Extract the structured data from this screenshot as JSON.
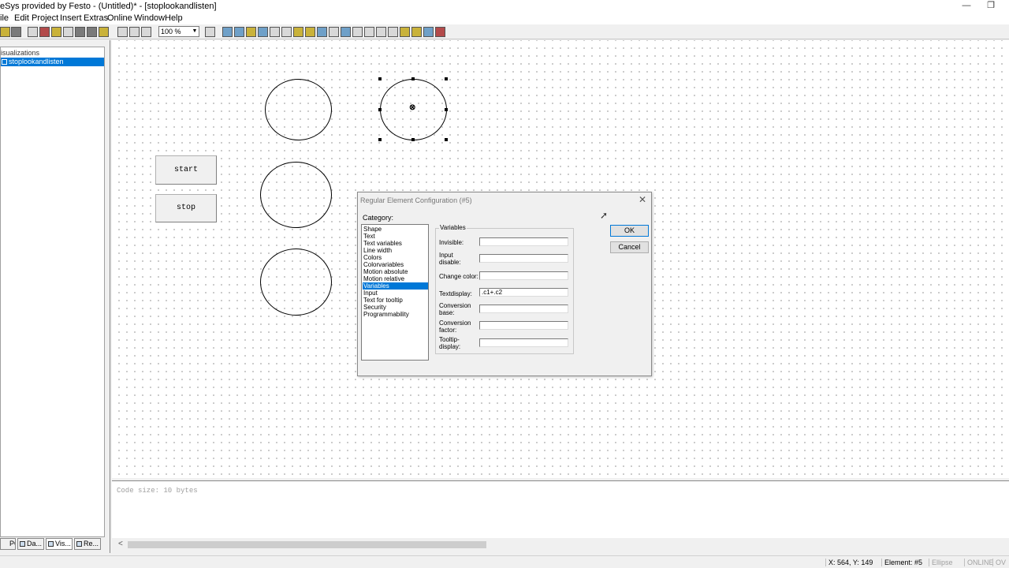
{
  "window": {
    "title": "eSys provided by Festo - (Untitled)* - [stoplookandlisten]",
    "minimize_glyph": "—",
    "restore_glyph": "❐"
  },
  "menu": [
    "ile",
    "Edit",
    "Project",
    "Insert",
    "Extras",
    "Online",
    "Window",
    "Help"
  ],
  "toolbar": {
    "zoom_value": "100 %",
    "zoom_arrow": "▼"
  },
  "left_panel": {
    "root_label": "isualizations",
    "selected_item": "stoplookandlisten",
    "tabs": [
      "PO...",
      "Da...",
      "Vis...",
      "Re..."
    ]
  },
  "canvas": {
    "buttons": [
      "start",
      "stop"
    ],
    "selected_marker": "⊗"
  },
  "dialog": {
    "title": "Regular Element Configuration (#5)",
    "close_glyph": "✕",
    "category_label": "Category:",
    "categories": [
      "Shape",
      "Text",
      "Text variables",
      "Line width",
      "Colors",
      "Colorvariables",
      "Motion absolute",
      "Motion relative",
      "Variables",
      "Input",
      "Text for tooltip",
      "Security",
      "Programmability"
    ],
    "selected_category": "Variables",
    "group_title": "Variables",
    "fields": [
      {
        "label": "Invisible:",
        "value": ""
      },
      {
        "label": "Input disable:",
        "value": ""
      },
      {
        "label": "Change color:",
        "value": ""
      },
      {
        "label": "Textdisplay:",
        "value": ".c1+.c2"
      },
      {
        "label": "Conversion base:",
        "value": ""
      },
      {
        "label": "Conversion factor:",
        "value": ""
      },
      {
        "label": "Tooltip-display:",
        "value": ""
      }
    ],
    "ok_label": "OK",
    "cancel_label": "Cancel"
  },
  "messages": {
    "text": "Code size: 10 bytes",
    "scroll_left": "<"
  },
  "status_bar": {
    "coords": "X: 564, Y: 149",
    "element": "Element: #5",
    "shape": "Ellipse",
    "online": "ONLINE",
    "ov": "OV"
  }
}
